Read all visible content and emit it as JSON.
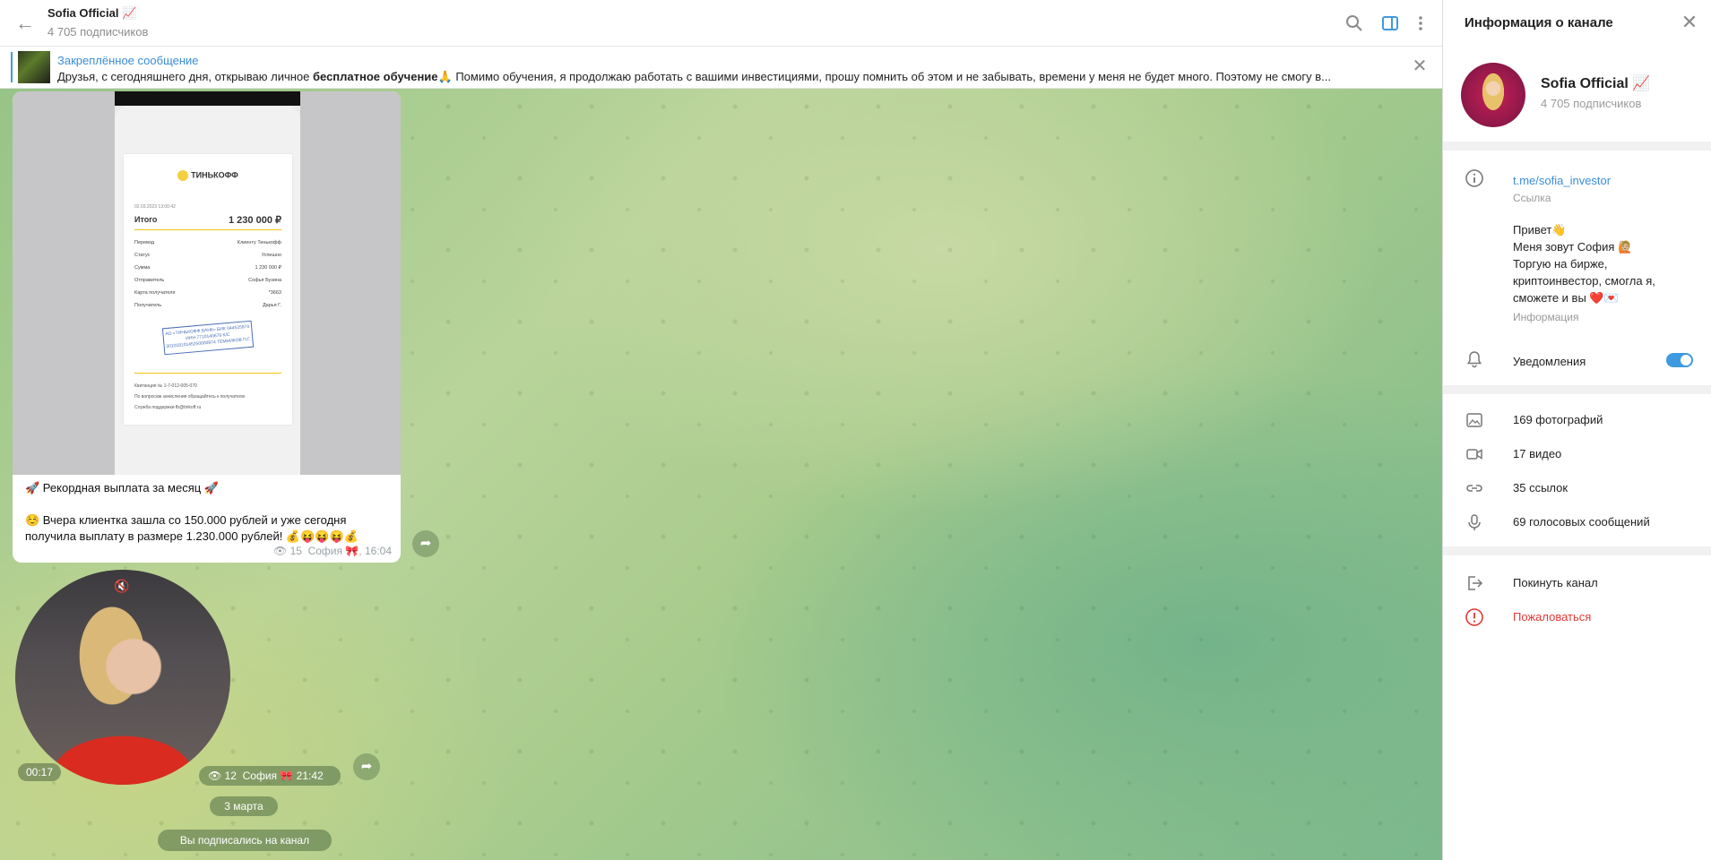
{
  "header": {
    "title": "Sofia Official 📈",
    "subscribers": "4 705 подписчиков"
  },
  "pinned": {
    "title": "Закреплённое сообщение",
    "text_before": "Друзья, с сегодняшнего дня, открываю личное ",
    "text_bold": "бесплатное обучение",
    "text_after": "🙏 Помимо обучения, я продолжаю работать с вашими инвестициями, прошу помнить об этом и не забывать, времени у меня не будет много. Поэтому не смогу в..."
  },
  "receipt": {
    "brand": "ТИНЬКОФФ",
    "date": "02.03.2023 13:00:42",
    "total_label": "Итого",
    "total_value": "1 230 000 ₽",
    "rows": [
      {
        "label": "Перевод",
        "value": "Клиенту Тинькофф"
      },
      {
        "label": "Статус",
        "value": "Успешно"
      },
      {
        "label": "Сумма",
        "value": "1 230 000 ₽"
      },
      {
        "label": "Отправитель",
        "value": "Софья Бузина"
      },
      {
        "label": "Карта получателя",
        "value": "*3663"
      },
      {
        "label": "Получатель",
        "value": "Дарья Г."
      }
    ],
    "stamp": "АО «ТИНЬКОФФ БАНК» БИК 044525974 ИНН 7710140679 К/С 30101810145250000974 ТЕМНИКОВ П.Г.",
    "receipt_no": "Квитанция № 1-7-012-005-070",
    "footer1": "По вопросам зачисления обращайтесь к получателю",
    "footer2": "Служба поддержки fb@tinkoff.ru"
  },
  "message1": {
    "line1": "🚀  Рекордная выплата за месяц 🚀",
    "line2": "☺️ Вчера клиентка зашла со 150.000 рублей и уже сегодня получила выплату в размере 1.230.000 рублей! 💰😝😝😝💰",
    "views": "15",
    "author": "София 🎀",
    "time": "16:04"
  },
  "message2": {
    "duration": "00:17",
    "views": "12",
    "author": "София 🎀",
    "time": "21:42"
  },
  "date_separator": "3 марта",
  "service_message": "Вы подписались на канал",
  "info_panel": {
    "title": "Информация о канале",
    "name": "Sofia Official 📈",
    "subscribers": "4 705 подписчиков",
    "link": "t.me/sofia_investor",
    "link_caption": "Ссылка",
    "description": [
      "Привет👋",
      "Меня зовут София 🙋🏼",
      "Торгую на бирже,",
      "криптоинвестор, смогла я,",
      "сможете и вы ❤️💌"
    ],
    "description_caption": "Информация",
    "notifications_label": "Уведомления",
    "notifications_on": true,
    "media": [
      {
        "icon": "photo-icon",
        "label": "169 фотографий"
      },
      {
        "icon": "video-icon",
        "label": "17 видео"
      },
      {
        "icon": "link-icon",
        "label": "35 ссылок"
      },
      {
        "icon": "microphone-icon",
        "label": "69 голосовых сообщений"
      }
    ],
    "leave_label": "Покинуть канал",
    "report_label": "Пожаловаться"
  },
  "colors": {
    "accent": "#3f9ae0",
    "danger": "#e53935"
  }
}
